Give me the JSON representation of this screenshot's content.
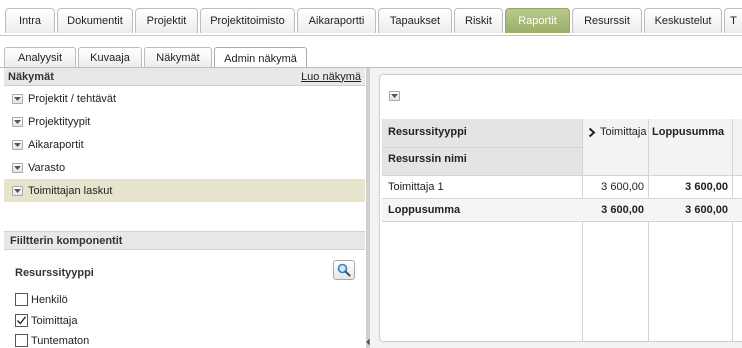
{
  "top_tabs": [
    {
      "label": "Intra",
      "active": false
    },
    {
      "label": "Dokumentit",
      "active": false
    },
    {
      "label": "Projektit",
      "active": false
    },
    {
      "label": "Projektitoimisto",
      "active": false
    },
    {
      "label": "Aikaraportti",
      "active": false
    },
    {
      "label": "Tapaukset",
      "active": false
    },
    {
      "label": "Riskit",
      "active": false
    },
    {
      "label": "Raportit",
      "active": true
    },
    {
      "label": "Resurssit",
      "active": false
    },
    {
      "label": "Keskustelut",
      "active": false
    },
    {
      "label": "T",
      "active": false
    }
  ],
  "sub_tabs": [
    {
      "label": "Analyysit",
      "active": false
    },
    {
      "label": "Kuvaaja",
      "active": false
    },
    {
      "label": "Näkymät",
      "active": false
    },
    {
      "label": "Admin näkymä",
      "active": true
    }
  ],
  "views": {
    "header": "Näkymät",
    "create_link": "Luo näkymä",
    "items": [
      {
        "label": "Projektit / tehtävät",
        "selected": false
      },
      {
        "label": "Projektityypit",
        "selected": false
      },
      {
        "label": "Aikaraportit",
        "selected": false
      },
      {
        "label": "Varasto",
        "selected": false
      },
      {
        "label": "Toimittajan laskut",
        "selected": true
      }
    ]
  },
  "filters": {
    "header": "Fiiltterin komponentit",
    "group_label": "Resurssityyppi",
    "options": [
      {
        "label": "Henkilö",
        "checked": false
      },
      {
        "label": "Toimittaja",
        "checked": true
      },
      {
        "label": "Tuntematon",
        "checked": false
      }
    ]
  },
  "pivot": {
    "row_field_1": "Resurssityyppi",
    "row_field_2": "Resurssin nimi",
    "col_header_1": "Toimittaja",
    "col_header_2": "Loppusumma",
    "rows": [
      {
        "label": "Toimittaja 1",
        "value": "3 600,00",
        "total": "3 600,00"
      },
      {
        "label": "Loppusumma",
        "value": "3 600,00",
        "total": "3 600,00"
      }
    ]
  },
  "colors": {
    "active_tab": "#a4b673",
    "selected_row": "#e6e4cc",
    "header_bg": "#e8e8e8"
  }
}
